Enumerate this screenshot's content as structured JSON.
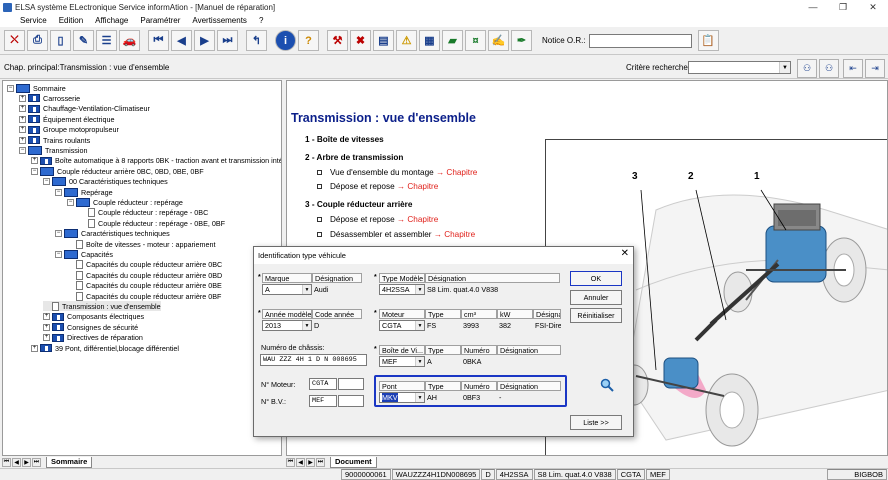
{
  "window": {
    "title": "ELSA système ELectronique Service informAtion - [Manuel de réparation]",
    "controls": [
      "minimize",
      "restore",
      "close"
    ]
  },
  "menu": [
    "Service",
    "Edition",
    "Affichage",
    "Paramétrer",
    "Avertissements",
    "?"
  ],
  "toolbar": {
    "notice_label": "Notice O.R.:",
    "notice_value": ""
  },
  "subheader": {
    "chapter": "Chap. principal:Transmission : vue d'ensemble",
    "criteria_label": "Critère recherche:",
    "criteria_value": ""
  },
  "tree": [
    {
      "label": "Sommaire",
      "level": 0,
      "expander": "−",
      "icon": "open"
    },
    {
      "label": "Carrosserie",
      "level": 1,
      "expander": "+",
      "icon": "closed"
    },
    {
      "label": "Chauffage-Ventilation-Climatiseur",
      "level": 1,
      "expander": "+",
      "icon": "closed"
    },
    {
      "label": "Équipement électrique",
      "level": 1,
      "expander": "+",
      "icon": "closed"
    },
    {
      "label": "Groupe motopropulseur",
      "level": 1,
      "expander": "+",
      "icon": "closed"
    },
    {
      "label": "Trains roulants",
      "level": 1,
      "expander": "+",
      "icon": "closed"
    },
    {
      "label": "Transmission",
      "level": 1,
      "expander": "−",
      "icon": "open"
    },
    {
      "label": "Boîte automatique à 8 rapports 0BK - traction avant et transmission intégr",
      "level": 2,
      "expander": "+",
      "icon": "closed"
    },
    {
      "label": "Couple réducteur arrière 0BC, 0BD, 0BE, 0BF",
      "level": 2,
      "expander": "−",
      "icon": "open"
    },
    {
      "label": "00 Caractéristiques techniques",
      "level": 3,
      "expander": "−",
      "icon": "open"
    },
    {
      "label": "Repérage",
      "level": 4,
      "expander": "−",
      "icon": "open"
    },
    {
      "label": "Couple réducteur : repérage",
      "level": 5,
      "expander": "−",
      "icon": "open"
    },
    {
      "label": "Couple réducteur : repérage - 0BC",
      "level": 6,
      "expander": "",
      "icon": "page"
    },
    {
      "label": "Couple réducteur : repérage - 0BE, 0BF",
      "level": 6,
      "expander": "",
      "icon": "page"
    },
    {
      "label": "Caractéristiques techniques",
      "level": 4,
      "expander": "−",
      "icon": "open"
    },
    {
      "label": "Boîte de vitesses - moteur : appariement",
      "level": 5,
      "expander": "",
      "icon": "page"
    },
    {
      "label": "Capacités",
      "level": 4,
      "expander": "−",
      "icon": "open"
    },
    {
      "label": "Capacités du couple réducteur arrière 0BC",
      "level": 5,
      "expander": "",
      "icon": "page"
    },
    {
      "label": "Capacités du couple réducteur arrière 0BD",
      "level": 5,
      "expander": "",
      "icon": "page"
    },
    {
      "label": "Capacités du couple réducteur arrière 0BE",
      "level": 5,
      "expander": "",
      "icon": "page"
    },
    {
      "label": "Capacités du couple réducteur arrière 0BF",
      "level": 5,
      "expander": "",
      "icon": "page"
    },
    {
      "label": "Transmission : vue d'ensemble",
      "level": 3,
      "expander": "",
      "icon": "page",
      "selected": true
    },
    {
      "label": "Composants électriques",
      "level": 3,
      "expander": "+",
      "icon": "closed"
    },
    {
      "label": "Consignes de sécurité",
      "level": 3,
      "expander": "+",
      "icon": "closed"
    },
    {
      "label": "Directives de réparation",
      "level": 3,
      "expander": "+",
      "icon": "closed"
    },
    {
      "label": "39 Pont, différentiel,blocage différentiel",
      "level": 2,
      "expander": "+",
      "icon": "closed"
    }
  ],
  "left_tab": "Sommaire",
  "right_tab": "Document",
  "document": {
    "title": "Transmission : vue d'ensemble",
    "lines": [
      {
        "type": "h",
        "text": "1 - Boîte de vitesses"
      },
      {
        "type": "h",
        "text": "2 - Arbre de transmission"
      },
      {
        "type": "b",
        "text": "Vue d'ensemble du montage ",
        "link": "→ Chapitre"
      },
      {
        "type": "b",
        "text": "Dépose et repose ",
        "link": "→ Chapitre"
      },
      {
        "type": "h",
        "text": "3 - Couple réducteur arrière"
      },
      {
        "type": "b",
        "text": "Dépose et repose ",
        "link": "→ Chapitre"
      },
      {
        "type": "b",
        "text": "Désassembler et assembler ",
        "link": "→ Chapitre"
      }
    ],
    "figure_callouts": [
      "3",
      "2",
      "1"
    ]
  },
  "dialog": {
    "title": "Identification type véhicule",
    "marque": {
      "label": "Marque",
      "value": "A",
      "des_label": "Désignation",
      "des_value": "Audi"
    },
    "type_modele": {
      "label": "Type Modèle",
      "value": "4H2SSA",
      "des_label": "Désignation",
      "des_value": "S8 Lim. quat.4.0 V838"
    },
    "annee": {
      "label": "Année modèle",
      "value": "2013",
      "code_label": "Code année",
      "code_value": "D"
    },
    "moteur": {
      "label": "Moteur",
      "value": "CGTA",
      "cols": [
        "Type",
        "cm³",
        "kW",
        "Désigna"
      ],
      "vals": [
        "FS",
        "3993",
        "382",
        "FSI-Dire"
      ]
    },
    "chassis": {
      "label": "Numéro de châssis:",
      "value": "WAU ZZZ 4H 1 D N 008695"
    },
    "boite": {
      "label": "Boîte de Vi...",
      "value": "MEF",
      "cols": [
        "Type",
        "Numéro",
        "Désignation"
      ],
      "vals": [
        "A",
        "0BKA",
        ""
      ]
    },
    "n_moteur": {
      "label": "N° Moteur:",
      "value": "CGTA"
    },
    "n_bv": {
      "label": "N° B.V.:",
      "value": "MEF"
    },
    "pont": {
      "label": "Pont",
      "value": "MKV",
      "cols": [
        "Type",
        "Numéro",
        "Désignation"
      ],
      "vals": [
        "AH",
        "0BF3",
        "-"
      ]
    },
    "buttons": {
      "ok": "OK",
      "annuler": "Annuler",
      "reinit": "Réinitialiser",
      "liste": "Liste >>"
    }
  },
  "statusbar": [
    "9000000061",
    "WAUZZZ4H1DN008695",
    "D",
    "4H2SSA",
    "S8 Lim. quat.4.0 V838",
    "CGTA",
    "MEF",
    "BIGBOB"
  ],
  "colors": {
    "title_blue": "#0b1f8a",
    "link_red": "#e0201a",
    "highlight": "#1a36c4"
  }
}
